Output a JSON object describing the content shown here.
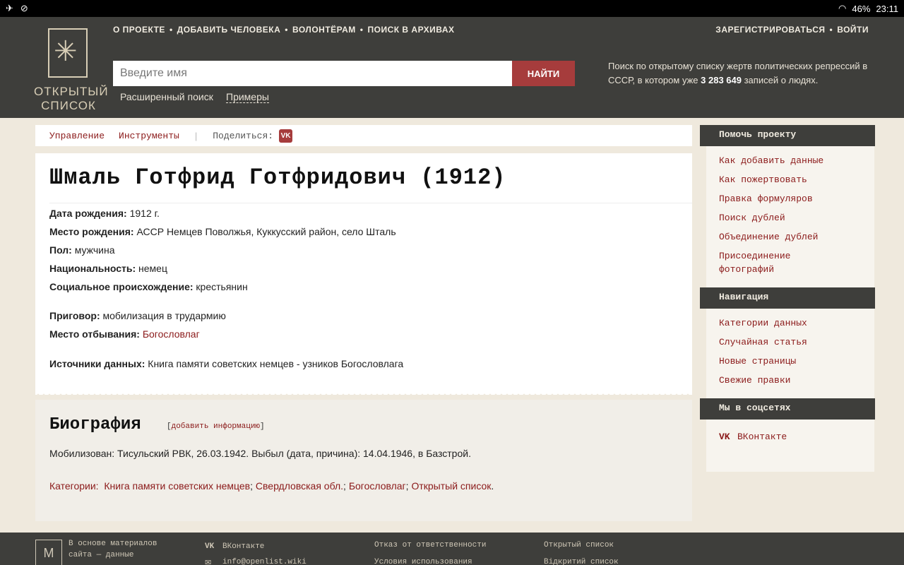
{
  "statusbar": {
    "battery": "46%",
    "time": "23:11"
  },
  "header": {
    "logo_line1": "ОТКРЫТЫЙ",
    "logo_line2": "СПИСОК",
    "nav": [
      "О ПРОЕКТЕ",
      "ДОБАВИТЬ ЧЕЛОВЕКА",
      "ВОЛОНТЁРАМ",
      "ПОИСК В АРХИВАХ"
    ],
    "auth": [
      "ЗАРЕГИСТРИРОВАТЬСЯ",
      "ВОЙТИ"
    ],
    "search_placeholder": "Введите имя",
    "search_button": "НАЙТИ",
    "advanced_search": "Расширенный поиск",
    "examples": "Примеры",
    "tagline_part1": "Поиск по открытому списку жертв политических репрессий в СССР, в котором уже ",
    "tagline_count": "3 283 649",
    "tagline_part2": " записей о людях."
  },
  "toolbar": {
    "manage": "Управление",
    "tools": "Инструменты",
    "divider": "|",
    "share": "Поделиться:",
    "vk": "VK"
  },
  "person": {
    "name": "Шмаль Готфрид Готфридович (1912)",
    "fields": [
      {
        "label": "Дата рождения:",
        "value": " 1912 г."
      },
      {
        "label": "Место рождения:",
        "value": " АССР Немцев Поволжья, Куккусский район, село Шталь"
      },
      {
        "label": "Пол:",
        "value": " мужчина"
      },
      {
        "label": "Национальность:",
        "value": " немец"
      },
      {
        "label": "Социальное происхождение:",
        "value": " крестьянин"
      },
      {
        "label": "Приговор:",
        "value": " мобилизация в трудармию"
      },
      {
        "label": "Место отбывания:",
        "value": "Богословлаг"
      },
      {
        "label": "Источники данных:",
        "value": " Книга памяти советских немцев - узников Богословлага"
      }
    ]
  },
  "biography": {
    "title": "Биография",
    "add_open": "[",
    "add_link": "добавить информацию",
    "add_close": "]",
    "text": "Мобилизован: Тисульский РВК, 26.03.1942. Выбыл (дата, причина): 14.04.1946, в Базстрой.",
    "categories_label": "Категории:",
    "categories": [
      "Книга памяти советских немцев",
      "Свердловская обл.",
      "Богословлаг",
      "Открытый список"
    ]
  },
  "sidebar": {
    "help_title": "Помочь проекту",
    "help_links": [
      "Как добавить данные",
      "Как пожертвовать",
      "Правка формуляров",
      "Поиск дублей",
      "Объединение дублей",
      "Присоединение фотографий"
    ],
    "nav_title": "Навигация",
    "nav_links": [
      "Категории данных",
      "Случайная статья",
      "Новые страницы",
      "Свежие правки"
    ],
    "social_title": "Мы в соцсетях",
    "social_links": [
      "ВКонтакте"
    ]
  },
  "footer": {
    "about_line1": "В основе материалов",
    "about_line2": "сайта — данные",
    "vk": "ВКонтакте",
    "email": "info@openlist.wiki",
    "disclaimer": "Отказ от ответственности",
    "terms": "Условия использования",
    "ru_name": "Открытый список",
    "ua_name": "Відкритий список"
  },
  "colors": {
    "accent": "#8b1a1a",
    "header_bg": "#3e3e3b",
    "button": "#a63c3c"
  }
}
